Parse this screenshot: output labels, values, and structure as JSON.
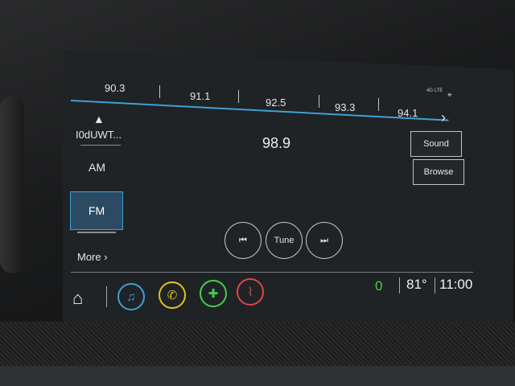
{
  "frequency_bar": {
    "presets": [
      "90.3",
      "91.1",
      "92.5",
      "93.3",
      "94.1"
    ]
  },
  "status": {
    "network": "4G LTE",
    "location_icon": "location-pin-icon"
  },
  "sidebar": {
    "station_name": "I0dUWT...",
    "am_label": "AM",
    "fm_label": "FM",
    "more_label": "More ›"
  },
  "main": {
    "current_frequency": "98.9",
    "sound_label": "Sound",
    "browse_label": "Browse",
    "tune_label": "Tune"
  },
  "bottom_bar": {
    "notification_count": "0",
    "temperature": "81°",
    "time": "11:00",
    "apps": [
      {
        "name": "music-icon",
        "color": "#3fa0d8"
      },
      {
        "name": "phone-icon",
        "color": "#e3c21b"
      },
      {
        "name": "navigation-icon",
        "color": "#44d04a"
      },
      {
        "name": "seat-icon",
        "color": "#e04545"
      }
    ]
  }
}
